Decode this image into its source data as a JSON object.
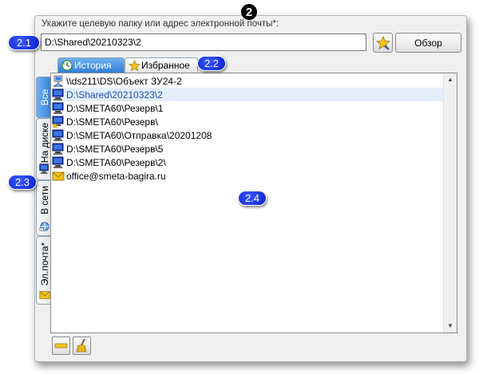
{
  "callouts": {
    "main": "2",
    "c21": "2.1",
    "c22": "2.2",
    "c23": "2.3",
    "c24": "2.4"
  },
  "prompt_text": "Укажите целевую папку или адрес электронной почты*:",
  "path_value": "D:\\Shared\\20210323\\2",
  "browse_label": "Обзор",
  "tabs": {
    "history": "История",
    "favorites": "Избранное"
  },
  "side_tabs": {
    "all": "Все",
    "disk": "На диске",
    "network": "В сети",
    "email": "Эл.почта*"
  },
  "items": [
    {
      "label": "\\\\ds211\\DS\\Объект ЗУ24-2",
      "icon": "network-computer-icon",
      "selected": false
    },
    {
      "label": "D:\\Shared\\20210323\\2",
      "icon": "computer-icon",
      "selected": true
    },
    {
      "label": "D:\\SMETA60\\Резерв\\1",
      "icon": "computer-icon",
      "selected": false
    },
    {
      "label": "D:\\SMETA60\\Резерв\\",
      "icon": "computer-star-icon",
      "selected": false
    },
    {
      "label": "D:\\SMETA60\\Отправка\\20201208",
      "icon": "computer-icon",
      "selected": false
    },
    {
      "label": "D:\\SMETA60\\Резерв\\5",
      "icon": "computer-icon",
      "selected": false
    },
    {
      "label": "D:\\SMETA60\\Резерв\\2\\",
      "icon": "computer-icon",
      "selected": false
    },
    {
      "label": "office@smeta-bagira.ru",
      "icon": "envelope-icon",
      "selected": false
    }
  ],
  "colors": {
    "active_tab": "#2f7fd8",
    "callout": "#0a1ec8",
    "selected_text": "#1b4fb6"
  }
}
